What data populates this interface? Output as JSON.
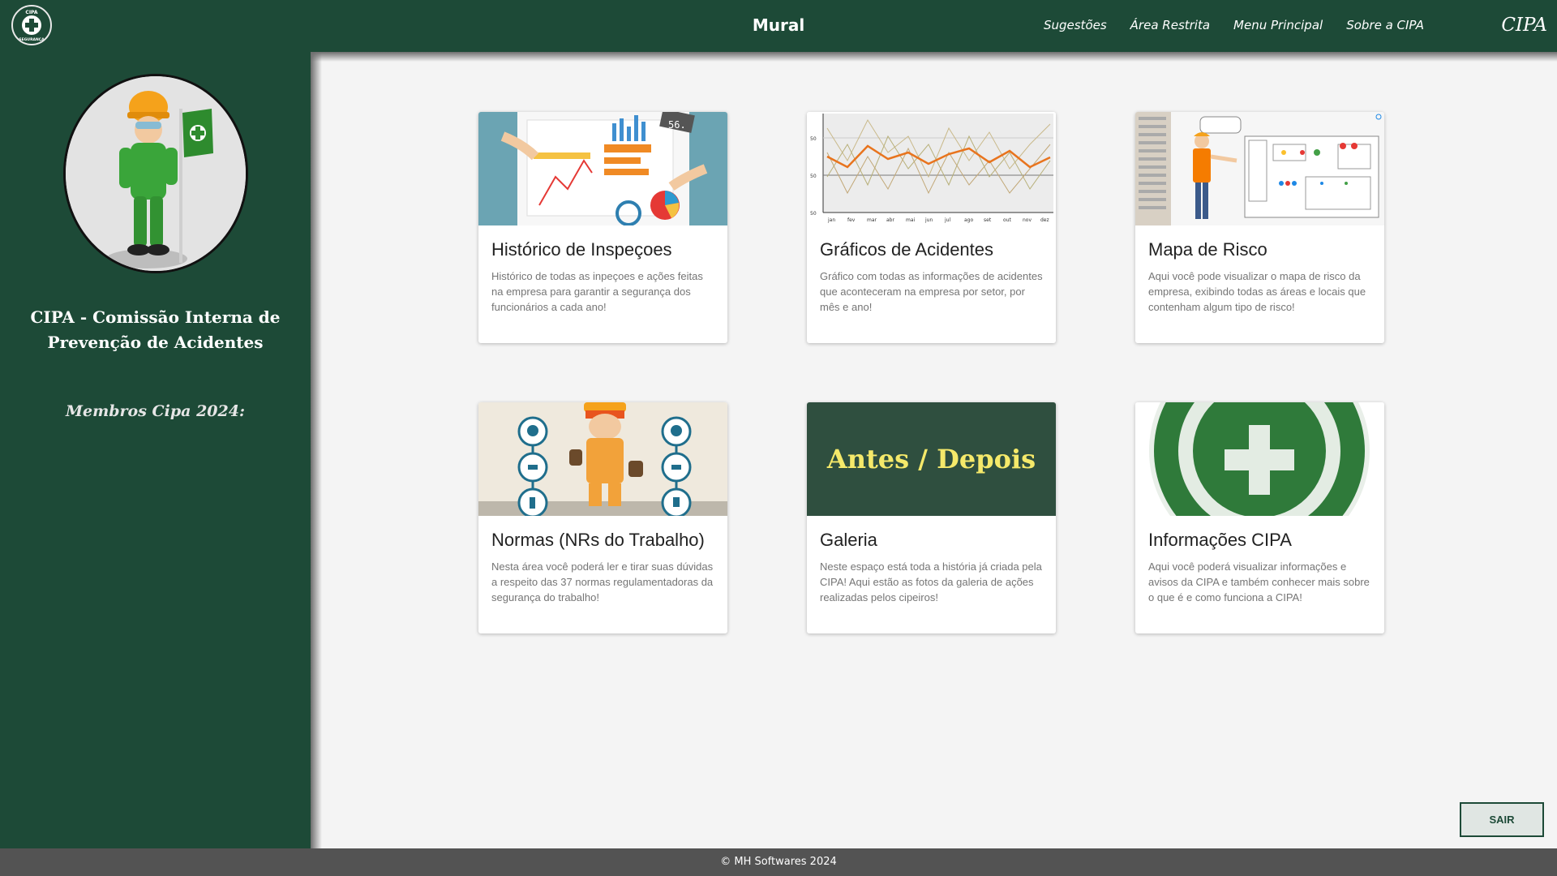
{
  "header": {
    "title": "Mural",
    "nav": [
      "Sugestões",
      "Área Restrita",
      "Menu Principal",
      "Sobre a CIPA"
    ],
    "brand": "CIPA",
    "logo_text": {
      "top": "CIPA",
      "bottom": "SEGURANÇA"
    }
  },
  "sidebar": {
    "title": "CIPA - Comissão Interna de Prevenção de Acidentes",
    "members_label": "Membros Cipa 2024:"
  },
  "cards": [
    {
      "title": "Histórico de Inspeçoes",
      "description": "Histórico de todas as inpeçoes e ações feitas na empresa para garantir a segurança dos funcionários a cada ano!"
    },
    {
      "title": "Gráficos de Acidentes",
      "description": "Gráfico com todas as informações de acidentes que aconteceram na empresa por setor, por mês e ano!"
    },
    {
      "title": "Mapa de Risco",
      "description": "Aqui você pode visualizar o mapa de risco da empresa, exibindo todas as áreas e locais que contenham algum tipo de risco!"
    },
    {
      "title": "Normas (NRs do Trabalho)",
      "description": "Nesta área você poderá ler e tirar suas dúvidas a respeito das 37 normas regulamentadoras da segurança do trabalho!"
    },
    {
      "title": "Galeria",
      "description": "Neste espaço está toda a história já criada pela CIPA! Aqui estão as fotos da galeria de ações realizadas pelos cipeiros!"
    },
    {
      "title": "Informações CIPA",
      "description": "Aqui você poderá visualizar informações e avisos da CIPA e também conhecer mais sobre o que é e como funciona a CIPA!"
    }
  ],
  "card_images": {
    "chart_months": [
      "jan",
      "fev",
      "mar",
      "abr",
      "mai",
      "jun",
      "jul",
      "ago",
      "set",
      "out",
      "nov",
      "dez"
    ],
    "chart_yticks": [
      "50",
      "50",
      "50"
    ],
    "gallery_text": "Antes / Depois",
    "calc_text": "56."
  },
  "logout_label": "SAIR",
  "footer": "© MH Softwares 2024",
  "colors": {
    "primary": "#1d4a37",
    "footer": "#535353",
    "background": "#f4f4f4",
    "gallery_text": "#f5e96a",
    "chart_orange": "#e8741e"
  }
}
